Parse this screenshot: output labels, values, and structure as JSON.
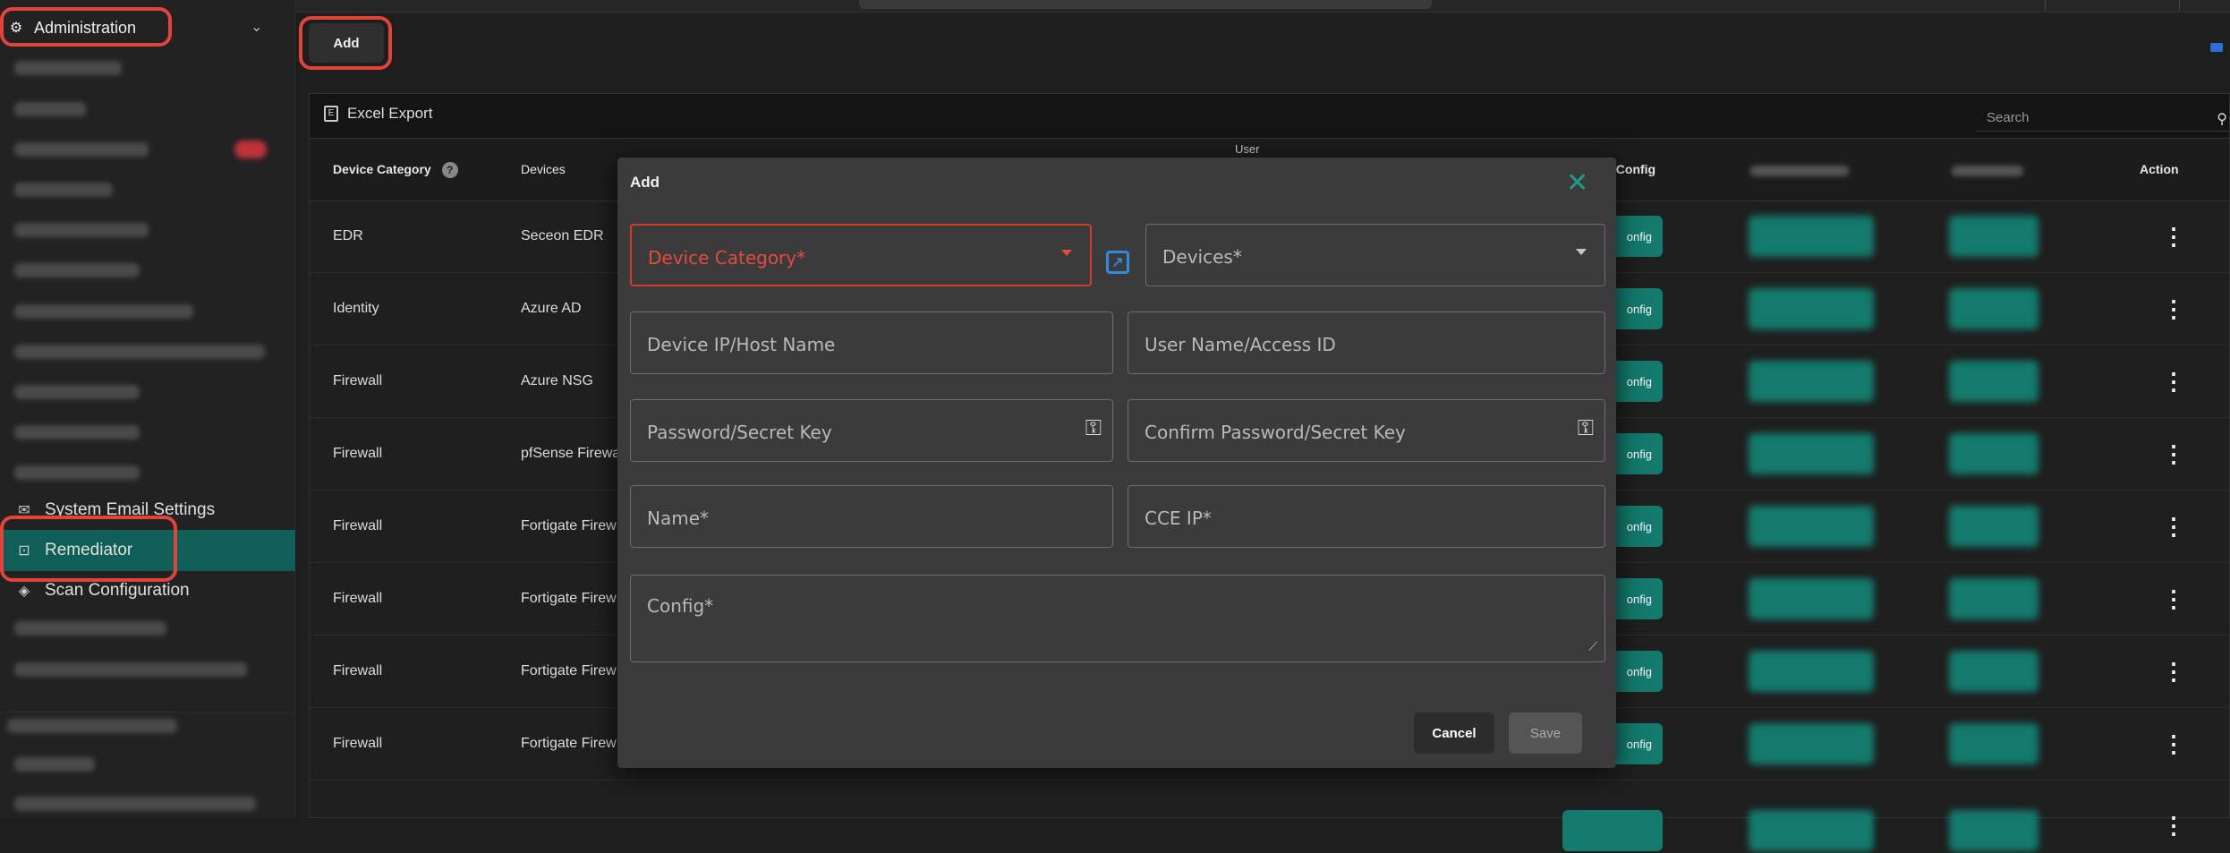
{
  "sidebar": {
    "section_title": "Administration",
    "section_icon": "admin-icon",
    "items": [
      {
        "label": "System Email Settings",
        "icon": "mail-icon"
      },
      {
        "label": "Remediator",
        "icon": "remediator-icon",
        "active": true
      },
      {
        "label": "Scan Configuration",
        "icon": "scan-icon"
      }
    ]
  },
  "toolbar": {
    "add_label": "Add"
  },
  "grid": {
    "export_label": "Excel Export",
    "search_placeholder": "Search",
    "headers": {
      "device_category": "Device Category",
      "devices": "Devices",
      "user": "User",
      "config": "l Config",
      "action": "Action"
    },
    "rows": [
      {
        "category": "EDR",
        "device": "Seceon EDR",
        "config_btn": "onfig"
      },
      {
        "category": "Identity",
        "device": "Azure AD",
        "config_btn": "onfig"
      },
      {
        "category": "Firewall",
        "device": "Azure NSG",
        "config_btn": "onfig"
      },
      {
        "category": "Firewall",
        "device": "pfSense Firewa",
        "config_btn": "onfig"
      },
      {
        "category": "Firewall",
        "device": "Fortigate Firew",
        "config_btn": "onfig"
      },
      {
        "category": "Firewall",
        "device": "Fortigate Firew",
        "config_btn": "onfig"
      },
      {
        "category": "Firewall",
        "device": "Fortigate Firew",
        "config_btn": "onfig"
      },
      {
        "category": "Firewall",
        "device": "Fortigate Firew",
        "config_btn": "onfig"
      }
    ]
  },
  "modal": {
    "title": "Add",
    "fields": {
      "device_category": "Device Category*",
      "devices": "Devices*",
      "device_ip": "Device IP/Host Name",
      "user_name": "User Name/Access ID",
      "password": "Password/Secret Key",
      "confirm_password": "Confirm Password/Secret Key",
      "name": "Name*",
      "cce_ip": "CCE IP*",
      "config": "Config*"
    },
    "cancel_label": "Cancel",
    "save_label": "Save"
  },
  "colors": {
    "accent": "#137a6d",
    "error": "#e24b3f",
    "annotation": "#e0443a",
    "link": "#2d8be0"
  }
}
